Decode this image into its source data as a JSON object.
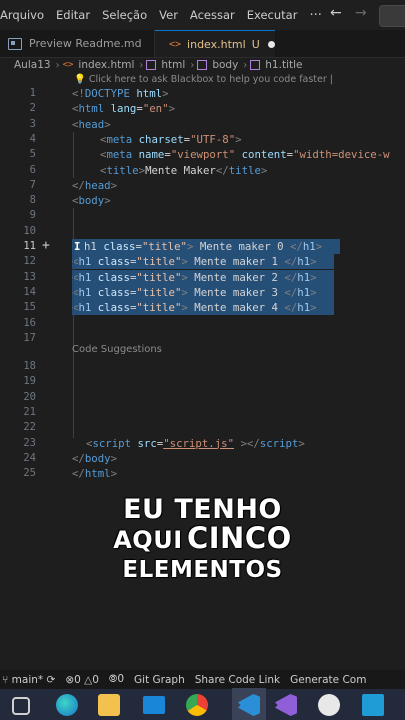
{
  "menubar": {
    "items": [
      "Arquivo",
      "Editar",
      "Seleção",
      "Ver",
      "Acessar",
      "Executar"
    ],
    "more": "···",
    "back_arrow": "←",
    "forward_arrow": "→"
  },
  "tabs": [
    {
      "label": "Preview Readme.md",
      "icon": "preview-icon",
      "active": false
    },
    {
      "label": "index.html",
      "icon": "html-icon",
      "icon_glyph": "<>",
      "status": "U",
      "modified": true,
      "active": true
    }
  ],
  "breadcrumb": [
    "Aula13",
    "index.html",
    "html",
    "body",
    "h1.title"
  ],
  "breadcrumb_icon_glyph": "<>",
  "blackbox_hint": "Click here to ask Blackbox to help you code faster |",
  "editor": {
    "current_line": 11,
    "selected_lines": [
      11,
      12,
      13,
      14,
      15
    ],
    "code_suggestions_label": "Code Suggestions",
    "lines": [
      {
        "n": "1",
        "tokens": [
          [
            "b",
            "<!"
          ],
          [
            "tag",
            "DOCTYPE"
          ],
          [
            "txt",
            " "
          ],
          [
            "attr",
            "html"
          ],
          [
            "b",
            ">"
          ]
        ]
      },
      {
        "n": "2",
        "tokens": [
          [
            "b",
            "<"
          ],
          [
            "tag",
            "html"
          ],
          [
            "txt",
            " "
          ],
          [
            "attr",
            "lang"
          ],
          [
            "txt",
            "="
          ],
          [
            "str",
            "\"en\""
          ],
          [
            "b",
            ">"
          ]
        ]
      },
      {
        "n": "3",
        "tokens": [
          [
            "b",
            "<"
          ],
          [
            "tag",
            "head"
          ],
          [
            "b",
            ">"
          ]
        ]
      },
      {
        "n": "4",
        "tokens": [
          [
            "b",
            "<"
          ],
          [
            "tag",
            "meta"
          ],
          [
            "txt",
            " "
          ],
          [
            "attr",
            "charset"
          ],
          [
            "txt",
            "="
          ],
          [
            "str",
            "\"UTF-8\""
          ],
          [
            "b",
            ">"
          ]
        ]
      },
      {
        "n": "5",
        "tokens": [
          [
            "b",
            "<"
          ],
          [
            "tag",
            "meta"
          ],
          [
            "txt",
            " "
          ],
          [
            "attr",
            "name"
          ],
          [
            "txt",
            "="
          ],
          [
            "str",
            "\"viewport\""
          ],
          [
            "txt",
            " "
          ],
          [
            "attr",
            "content"
          ],
          [
            "txt",
            "="
          ],
          [
            "str",
            "\"width=device-w"
          ]
        ]
      },
      {
        "n": "6",
        "tokens": [
          [
            "b",
            "<"
          ],
          [
            "tag",
            "title"
          ],
          [
            "b",
            ">"
          ],
          [
            "txt",
            "Mente Maker"
          ],
          [
            "b",
            "</"
          ],
          [
            "tag",
            "title"
          ],
          [
            "b",
            ">"
          ]
        ]
      },
      {
        "n": "7",
        "tokens": [
          [
            "b",
            "</"
          ],
          [
            "tag",
            "head"
          ],
          [
            "b",
            ">"
          ]
        ]
      },
      {
        "n": "8",
        "tokens": [
          [
            "b",
            "<"
          ],
          [
            "tag",
            "body"
          ],
          [
            "b",
            ">"
          ]
        ]
      },
      {
        "n": "9",
        "tokens": []
      },
      {
        "n": "10",
        "tokens": []
      },
      {
        "n": "11",
        "tokens": [
          [
            "txt",
            "h1 "
          ],
          [
            "attr",
            "class"
          ],
          [
            "txt",
            "="
          ],
          [
            "str",
            "\"title\""
          ],
          [
            "b",
            ">"
          ],
          [
            "txt",
            " Mente maker 0 "
          ],
          [
            "b",
            "</"
          ],
          [
            "tag",
            "h1"
          ],
          [
            "b",
            ">"
          ]
        ]
      },
      {
        "n": "12",
        "tokens": [
          [
            "b",
            "<"
          ],
          [
            "tag",
            "h1"
          ],
          [
            "txt",
            " "
          ],
          [
            "attr",
            "class"
          ],
          [
            "txt",
            "="
          ],
          [
            "str",
            "\"title\""
          ],
          [
            "b",
            ">"
          ],
          [
            "txt",
            " Mente maker 1 "
          ],
          [
            "b",
            "</"
          ],
          [
            "tag",
            "h1"
          ],
          [
            "b",
            ">"
          ]
        ]
      },
      {
        "n": "13",
        "tokens": [
          [
            "b",
            "<"
          ],
          [
            "tag",
            "h1"
          ],
          [
            "txt",
            " "
          ],
          [
            "attr",
            "class"
          ],
          [
            "txt",
            "="
          ],
          [
            "str",
            "\"title\""
          ],
          [
            "b",
            ">"
          ],
          [
            "txt",
            " Mente maker 2 "
          ],
          [
            "b",
            "</"
          ],
          [
            "tag",
            "h1"
          ],
          [
            "b",
            ">"
          ]
        ]
      },
      {
        "n": "14",
        "tokens": [
          [
            "b",
            "<"
          ],
          [
            "tag",
            "h1"
          ],
          [
            "txt",
            " "
          ],
          [
            "attr",
            "class"
          ],
          [
            "txt",
            "="
          ],
          [
            "str",
            "\"title\""
          ],
          [
            "b",
            ">"
          ],
          [
            "txt",
            " Mente maker 3 "
          ],
          [
            "b",
            "</"
          ],
          [
            "tag",
            "h1"
          ],
          [
            "b",
            ">"
          ]
        ]
      },
      {
        "n": "15",
        "tokens": [
          [
            "b",
            "<"
          ],
          [
            "tag",
            "h1"
          ],
          [
            "txt",
            " "
          ],
          [
            "attr",
            "class"
          ],
          [
            "txt",
            "="
          ],
          [
            "str",
            "\"title\""
          ],
          [
            "b",
            ">"
          ],
          [
            "txt",
            " Mente maker 4 "
          ],
          [
            "b",
            "</"
          ],
          [
            "tag",
            "h1"
          ],
          [
            "b",
            ">"
          ]
        ]
      },
      {
        "n": "16",
        "tokens": []
      },
      {
        "n": "17",
        "tokens": []
      },
      {
        "n": "18",
        "tokens": []
      },
      {
        "n": "19",
        "tokens": []
      },
      {
        "n": "20",
        "tokens": []
      },
      {
        "n": "21",
        "tokens": []
      },
      {
        "n": "22",
        "tokens": []
      },
      {
        "n": "23",
        "tokens": [
          [
            "b",
            "<"
          ],
          [
            "tag",
            "script"
          ],
          [
            "txt",
            " "
          ],
          [
            "attr",
            "src"
          ],
          [
            "txt",
            "="
          ],
          [
            "link",
            "\"script.js\""
          ],
          [
            "txt",
            " "
          ],
          [
            "b",
            "></"
          ],
          [
            "tag",
            "script"
          ],
          [
            "b",
            ">"
          ]
        ]
      },
      {
        "n": "24",
        "tokens": [
          [
            "b",
            "</"
          ],
          [
            "tag",
            "body"
          ],
          [
            "b",
            ">"
          ]
        ]
      },
      {
        "n": "25",
        "tokens": [
          [
            "b",
            "</"
          ],
          [
            "tag",
            "html"
          ],
          [
            "b",
            ">"
          ]
        ]
      }
    ]
  },
  "caption": {
    "line1": "EU TENHO",
    "line2a": "AQUI",
    "line2b": "CINCO",
    "line3": "ELEMENTOS"
  },
  "statusbar": {
    "branch": "main*",
    "errors": "0",
    "warnings": "0",
    "ports": "0",
    "git_graph": "Git Graph",
    "share_code_link": "Share Code Link",
    "generate": "Generate Com"
  },
  "colors": {
    "accent": "#0078d4",
    "selection": "#264f78",
    "modified_tab": "#e2c08d"
  },
  "taskbar": {
    "apps": [
      "task-view-icon",
      "edge-icon",
      "file-explorer-icon",
      "mail-icon",
      "chrome-icon",
      "vscode-icon",
      "visual-studio-icon",
      "obs-icon",
      "app-icon"
    ]
  }
}
